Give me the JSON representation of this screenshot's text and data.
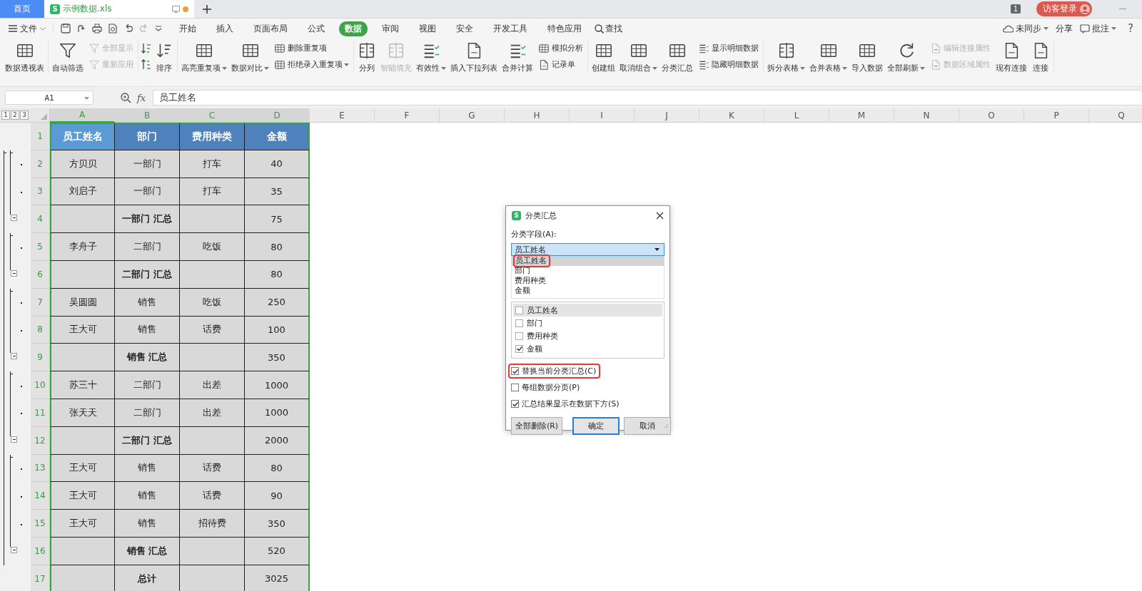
{
  "tabs": [
    {
      "label": "首页",
      "kind": "home",
      "selected": false,
      "modified": false
    },
    {
      "label": "示例数据.xls",
      "kind": "file",
      "selected": true,
      "modified": true,
      "logo": "S"
    }
  ],
  "title_bar": {
    "window_count": "1",
    "login": "访客登录"
  },
  "menu": {
    "file": "文件",
    "items": [
      {
        "label": "开始",
        "selected": false
      },
      {
        "label": "插入",
        "selected": false
      },
      {
        "label": "页面布局",
        "selected": false
      },
      {
        "label": "公式",
        "selected": false
      },
      {
        "label": "数据",
        "selected": true
      },
      {
        "label": "审阅",
        "selected": false
      },
      {
        "label": "视图",
        "selected": false
      },
      {
        "label": "安全",
        "selected": false
      },
      {
        "label": "开发工具",
        "selected": false
      },
      {
        "label": "特色应用",
        "selected": false
      }
    ],
    "search": "查找",
    "sync": "未同步",
    "share": "分享",
    "comment": "批注",
    "help": "?"
  },
  "ribbon": {
    "groups": [
      [
        {
          "label": "数据透视表",
          "kind": "large",
          "disabled": false,
          "dropdown": false
        }
      ],
      [
        {
          "label": "自动筛选",
          "kind": "large",
          "disabled": false,
          "dropdown": false
        },
        {
          "label": "全部显示",
          "kind": "small",
          "disabled": true,
          "dropdown": false
        },
        {
          "label": "重新应用",
          "kind": "small",
          "disabled": true,
          "dropdown": false
        }
      ],
      [
        {
          "label": "排序",
          "kind": "sort",
          "disabled": false,
          "dropdown": false
        }
      ],
      [
        {
          "label": "高亮重复项",
          "kind": "large",
          "disabled": false,
          "dropdown": true
        },
        {
          "label": "数据对比",
          "kind": "large",
          "disabled": false,
          "dropdown": true
        },
        {
          "label": "删除重复项",
          "kind": "small",
          "disabled": false,
          "dropdown": false
        },
        {
          "label": "拒绝录入重复项",
          "kind": "small",
          "disabled": false,
          "dropdown": true
        }
      ],
      [
        {
          "label": "分列",
          "kind": "large",
          "disabled": false,
          "dropdown": false
        },
        {
          "label": "智能填充",
          "kind": "large",
          "disabled": true,
          "dropdown": false
        },
        {
          "label": "有效性",
          "kind": "large",
          "disabled": false,
          "dropdown": true
        },
        {
          "label": "插入下拉列表",
          "kind": "large",
          "disabled": false,
          "dropdown": false
        },
        {
          "label": "合并计算",
          "kind": "large",
          "disabled": false,
          "dropdown": false
        },
        {
          "label": "模拟分析",
          "kind": "small",
          "disabled": false,
          "dropdown": false
        },
        {
          "label": "记录单",
          "kind": "small",
          "disabled": false,
          "dropdown": false
        }
      ],
      [
        {
          "label": "创建组",
          "kind": "large",
          "disabled": false,
          "dropdown": false
        },
        {
          "label": "取消组合",
          "kind": "large",
          "disabled": false,
          "dropdown": true
        },
        {
          "label": "分类汇总",
          "kind": "large",
          "disabled": false,
          "dropdown": false
        },
        {
          "label": "显示明细数据",
          "kind": "small",
          "disabled": false,
          "dropdown": false
        },
        {
          "label": "隐藏明细数据",
          "kind": "small",
          "disabled": false,
          "dropdown": false
        }
      ],
      [
        {
          "label": "拆分表格",
          "kind": "large",
          "disabled": false,
          "dropdown": true
        },
        {
          "label": "合并表格",
          "kind": "large",
          "disabled": false,
          "dropdown": true
        },
        {
          "label": "导入数据",
          "kind": "large",
          "disabled": false,
          "dropdown": false
        },
        {
          "label": "全部刷新",
          "kind": "large",
          "disabled": false,
          "dropdown": true
        },
        {
          "label": "编辑连接属性",
          "kind": "small",
          "disabled": true,
          "dropdown": false
        },
        {
          "label": "数据区域属性",
          "kind": "small",
          "disabled": true,
          "dropdown": false
        },
        {
          "label": "现有连接",
          "kind": "large",
          "disabled": false,
          "dropdown": false
        },
        {
          "label": "连接",
          "kind": "large",
          "disabled": false,
          "dropdown": false
        }
      ]
    ]
  },
  "formula_bar": {
    "cell": "A1",
    "fx": "fx",
    "value": "员工姓名"
  },
  "sheet": {
    "outline_levels": [
      "1",
      "2",
      "3"
    ],
    "columns": [
      {
        "label": "A",
        "selected": true,
        "active": true
      },
      {
        "label": "B",
        "selected": true,
        "active": false
      },
      {
        "label": "C",
        "selected": true,
        "active": false
      },
      {
        "label": "D",
        "selected": true,
        "active": false
      },
      {
        "label": "E",
        "selected": false,
        "active": false
      },
      {
        "label": "F",
        "selected": false,
        "active": false
      },
      {
        "label": "G",
        "selected": false,
        "active": false
      },
      {
        "label": "H",
        "selected": false,
        "active": false
      },
      {
        "label": "I",
        "selected": false,
        "active": false
      },
      {
        "label": "J",
        "selected": false,
        "active": false
      },
      {
        "label": "K",
        "selected": false,
        "active": false
      },
      {
        "label": "L",
        "selected": false,
        "active": false
      },
      {
        "label": "M",
        "selected": false,
        "active": false
      },
      {
        "label": "N",
        "selected": false,
        "active": false
      },
      {
        "label": "O",
        "selected": false,
        "active": false
      },
      {
        "label": "P",
        "selected": false,
        "active": false
      },
      {
        "label": "Q",
        "selected": false,
        "active": false
      }
    ],
    "rows": [
      {
        "number": "1",
        "kind": "header",
        "selected": true,
        "cells": [
          "员工姓名",
          "部门",
          "费用种类",
          "金额"
        ]
      },
      {
        "number": "2",
        "kind": "detail",
        "selected": true,
        "cells": [
          "方贝贝",
          "一部门",
          "打车",
          "40"
        ]
      },
      {
        "number": "3",
        "kind": "detail",
        "selected": true,
        "cells": [
          "刘启子",
          "一部门",
          "打车",
          "35"
        ]
      },
      {
        "number": "4",
        "kind": "subtotal",
        "selected": true,
        "cells": [
          null,
          "一部门 汇总",
          null,
          "75"
        ]
      },
      {
        "number": "5",
        "kind": "detail",
        "selected": true,
        "cells": [
          "李舟子",
          "二部门",
          "吃饭",
          "80"
        ]
      },
      {
        "number": "6",
        "kind": "subtotal",
        "selected": true,
        "cells": [
          null,
          "二部门 汇总",
          null,
          "80"
        ]
      },
      {
        "number": "7",
        "kind": "detail",
        "selected": true,
        "cells": [
          "吴圆圆",
          "销售",
          "吃饭",
          "250"
        ]
      },
      {
        "number": "8",
        "kind": "detail",
        "selected": true,
        "cells": [
          "王大可",
          "销售",
          "话费",
          "100"
        ]
      },
      {
        "number": "9",
        "kind": "subtotal",
        "selected": true,
        "cells": [
          null,
          "销售 汇总",
          null,
          "350"
        ]
      },
      {
        "number": "10",
        "kind": "detail",
        "selected": true,
        "cells": [
          "苏三十",
          "二部门",
          "出差",
          "1000"
        ]
      },
      {
        "number": "11",
        "kind": "detail",
        "selected": true,
        "cells": [
          "张天天",
          "二部门",
          "出差",
          "1000"
        ]
      },
      {
        "number": "12",
        "kind": "subtotal",
        "selected": true,
        "cells": [
          null,
          "二部门 汇总",
          null,
          "2000"
        ]
      },
      {
        "number": "13",
        "kind": "detail",
        "selected": true,
        "cells": [
          "王大可",
          "销售",
          "话费",
          "80"
        ]
      },
      {
        "number": "14",
        "kind": "detail",
        "selected": true,
        "cells": [
          "王大可",
          "销售",
          "话费",
          "90"
        ]
      },
      {
        "number": "15",
        "kind": "detail",
        "selected": true,
        "cells": [
          "王大可",
          "销售",
          "招待费",
          "350"
        ]
      },
      {
        "number": "16",
        "kind": "subtotal",
        "selected": true,
        "cells": [
          null,
          "销售 汇总",
          null,
          "520"
        ]
      },
      {
        "number": "17",
        "kind": "total",
        "selected": true,
        "cells": [
          null,
          "总计",
          null,
          "3025"
        ]
      }
    ]
  },
  "dialog": {
    "logo": "S",
    "title": "分类汇总",
    "field_label": "分类字段(A):",
    "field_value": "员工姓名",
    "field_options": [
      {
        "label": "员工姓名",
        "selected": true,
        "highlighted": true
      },
      {
        "label": "部门",
        "selected": false,
        "highlighted": false
      },
      {
        "label": "费用种类",
        "selected": false,
        "highlighted": false
      },
      {
        "label": "金额",
        "selected": false,
        "highlighted": false
      }
    ],
    "summary_items": [
      {
        "label": "员工姓名",
        "checked": false,
        "selected": true
      },
      {
        "label": "部门",
        "checked": false,
        "selected": false
      },
      {
        "label": "费用种类",
        "checked": false,
        "selected": false
      },
      {
        "label": "金额",
        "checked": true,
        "selected": false
      }
    ],
    "options": [
      {
        "label": "替换当前分类汇总(C)",
        "checked": true,
        "highlighted": true
      },
      {
        "label": "每组数据分页(P)",
        "checked": false,
        "highlighted": false
      },
      {
        "label": "汇总结果显示在数据下方(S)",
        "checked": true,
        "highlighted": false
      }
    ],
    "buttons": [
      {
        "label": "全部删除(R)",
        "kind": "normal"
      },
      {
        "label": "确定",
        "kind": "default"
      },
      {
        "label": "取消",
        "kind": "normal"
      }
    ]
  }
}
